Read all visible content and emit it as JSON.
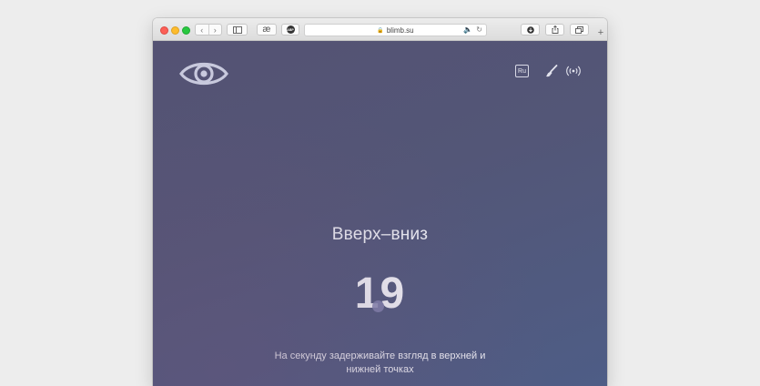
{
  "browser": {
    "url": "blimb.su",
    "reader_label": "æ",
    "adblock_label": "ABP"
  },
  "site": {
    "lang_label": "Ru"
  },
  "exercise": {
    "title": "Вверх–вниз",
    "counter": "19",
    "instruction": "На секунду задерживайте взгляд в верхней и нижней точках"
  },
  "colors": {
    "page_bg_start": "#545273",
    "page_bg_end": "#4e5d86",
    "text": "#eef0f6"
  },
  "icons": [
    "back-icon",
    "forward-icon",
    "sidebar-icon",
    "lock-icon",
    "speaker-icon",
    "reload-icon",
    "download-icon",
    "share-icon",
    "tabs-icon",
    "new-tab-icon",
    "eye-logo-icon",
    "brush-icon",
    "signal-icon"
  ]
}
